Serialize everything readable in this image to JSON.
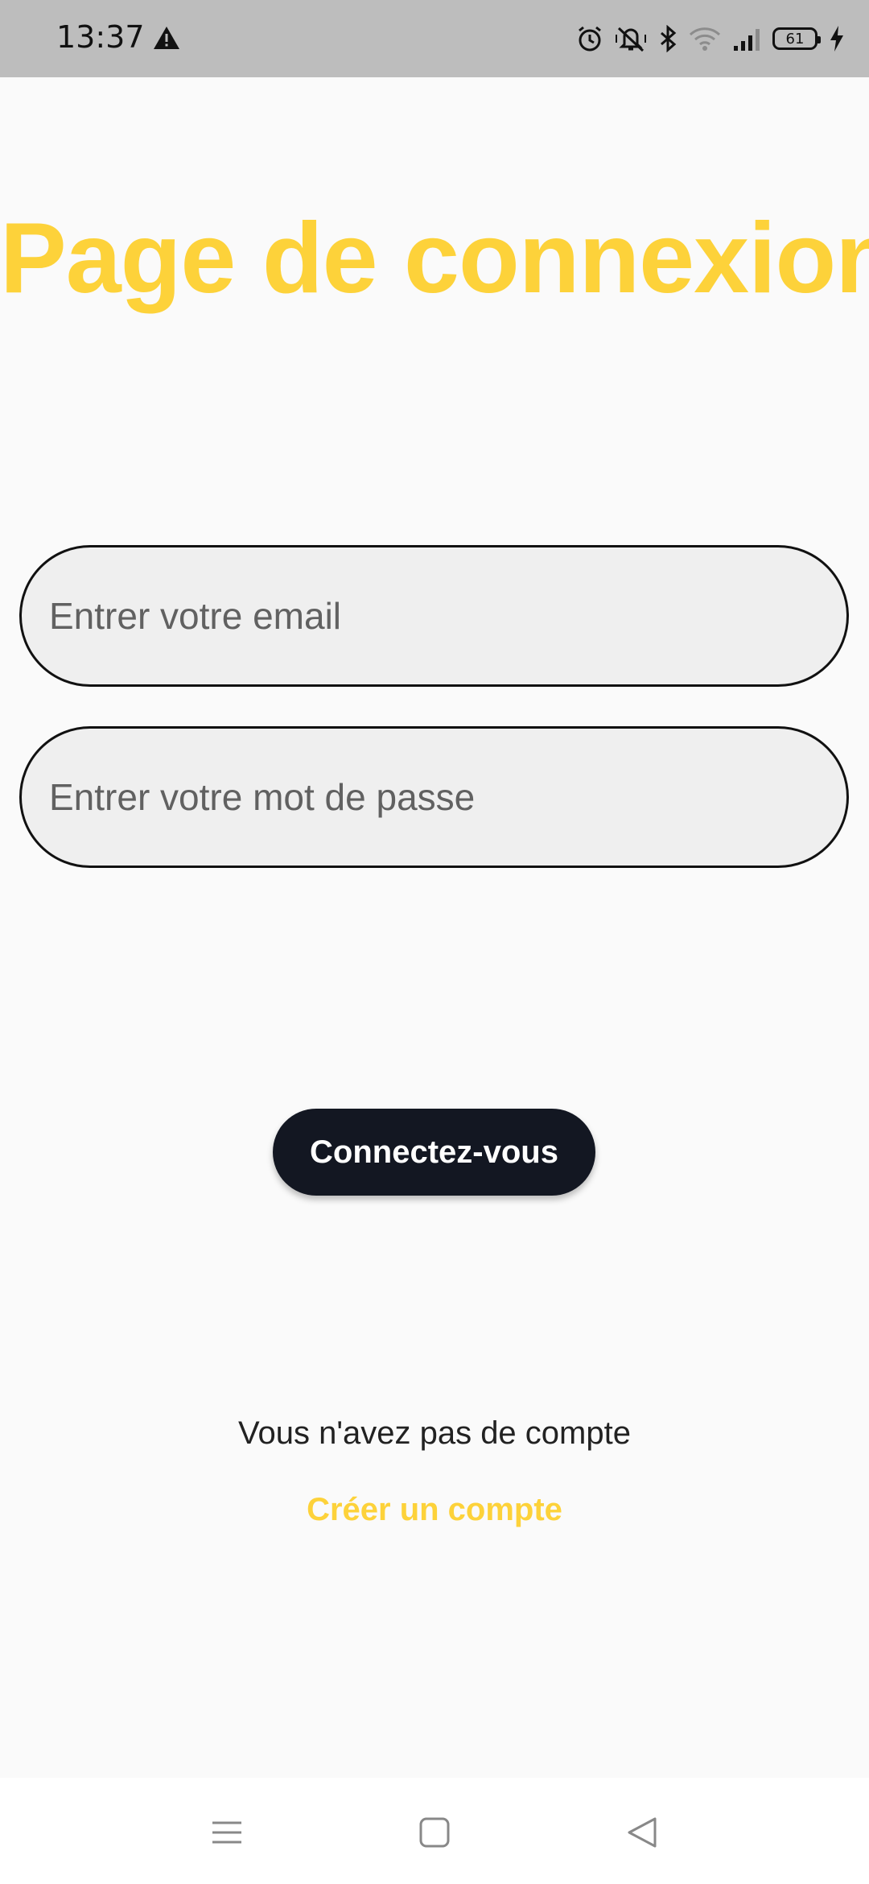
{
  "status_bar": {
    "time": "13:37",
    "battery_level": "61",
    "icons": [
      "warning-icon",
      "alarm-icon",
      "vibrate-icon",
      "bluetooth-icon",
      "wifi-icon",
      "signal-icon",
      "battery-icon",
      "charging-icon"
    ]
  },
  "page": {
    "title": "Page de connexion",
    "title_color": "#fdd23a"
  },
  "form": {
    "email_placeholder": "Entrer votre email",
    "email_value": "",
    "password_placeholder": "Entrer votre mot de passe",
    "password_value": "",
    "submit_label": "Connectez-vous",
    "button_color": "#131722"
  },
  "footer": {
    "no_account_text": "Vous n'avez pas de compte",
    "create_account_label": "Créer un compte"
  },
  "nav_bar": {
    "buttons": [
      "menu-icon",
      "home-icon",
      "back-icon"
    ]
  }
}
